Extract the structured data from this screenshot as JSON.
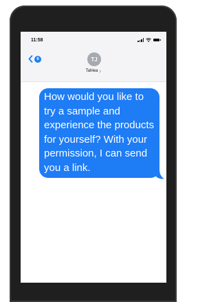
{
  "status_bar": {
    "time": "11:58"
  },
  "header": {
    "unread_count": "6",
    "avatar_initials": "TJ",
    "contact_name": "Tahlea"
  },
  "messages": [
    {
      "sender": "me",
      "text": "How would you like to try a sample and experience the products for yourself? With your permission, I can send you a link."
    }
  ],
  "colors": {
    "bubble": "#1e7cf5",
    "accent": "#1f7ff0",
    "avatar": "#a7a9b0",
    "phone_body": "#1f1f1f"
  },
  "icons": [
    "back-chevron-icon",
    "signal-icon",
    "wifi-icon",
    "battery-icon",
    "chevron-right-icon"
  ]
}
